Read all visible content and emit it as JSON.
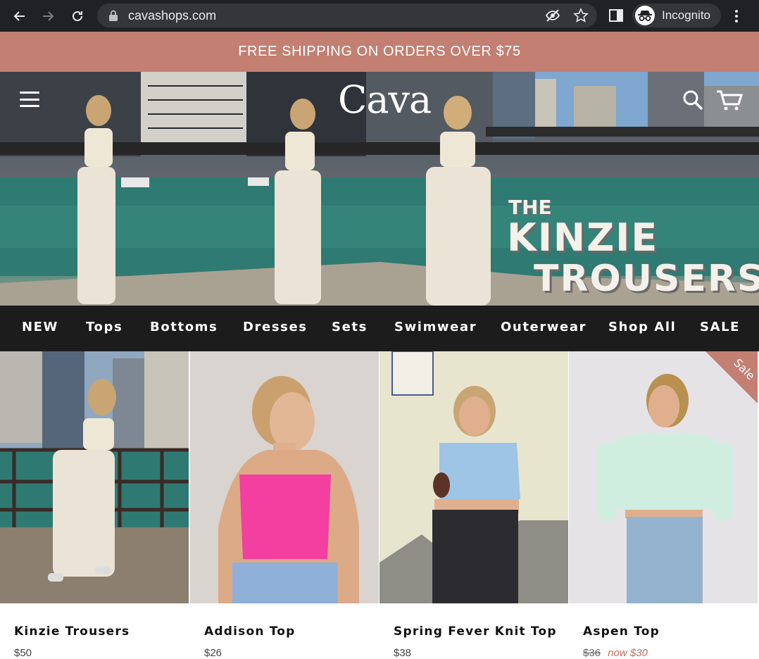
{
  "browser": {
    "url": "cavashops.com",
    "profile_label": "Incognito"
  },
  "promo": {
    "text": "FREE SHIPPING ON ORDERS OVER $75"
  },
  "hero": {
    "logo": "Cava",
    "headline_the": "THE",
    "headline_kinzie": "KINZIE",
    "headline_trousers": "TROUSERS"
  },
  "nav": {
    "items": [
      "NEW",
      "Tops",
      "Bottoms",
      "Dresses",
      "Sets",
      "Swimwear",
      "Outerwear",
      "Shop All",
      "SALE"
    ]
  },
  "products": [
    {
      "name": "Kinzie Trousers",
      "price": "$50"
    },
    {
      "name": "Addison Top",
      "price": "$26"
    },
    {
      "name": "Spring Fever Knit Top",
      "price": "$38"
    },
    {
      "name": "Aspen Top",
      "price_old": "$36",
      "price_now": "now $30",
      "badge": "Sale"
    }
  ],
  "colors": {
    "promo_bg": "#c27f72",
    "nav_bg": "#1c1c1c",
    "chrome_bg": "#202124"
  }
}
